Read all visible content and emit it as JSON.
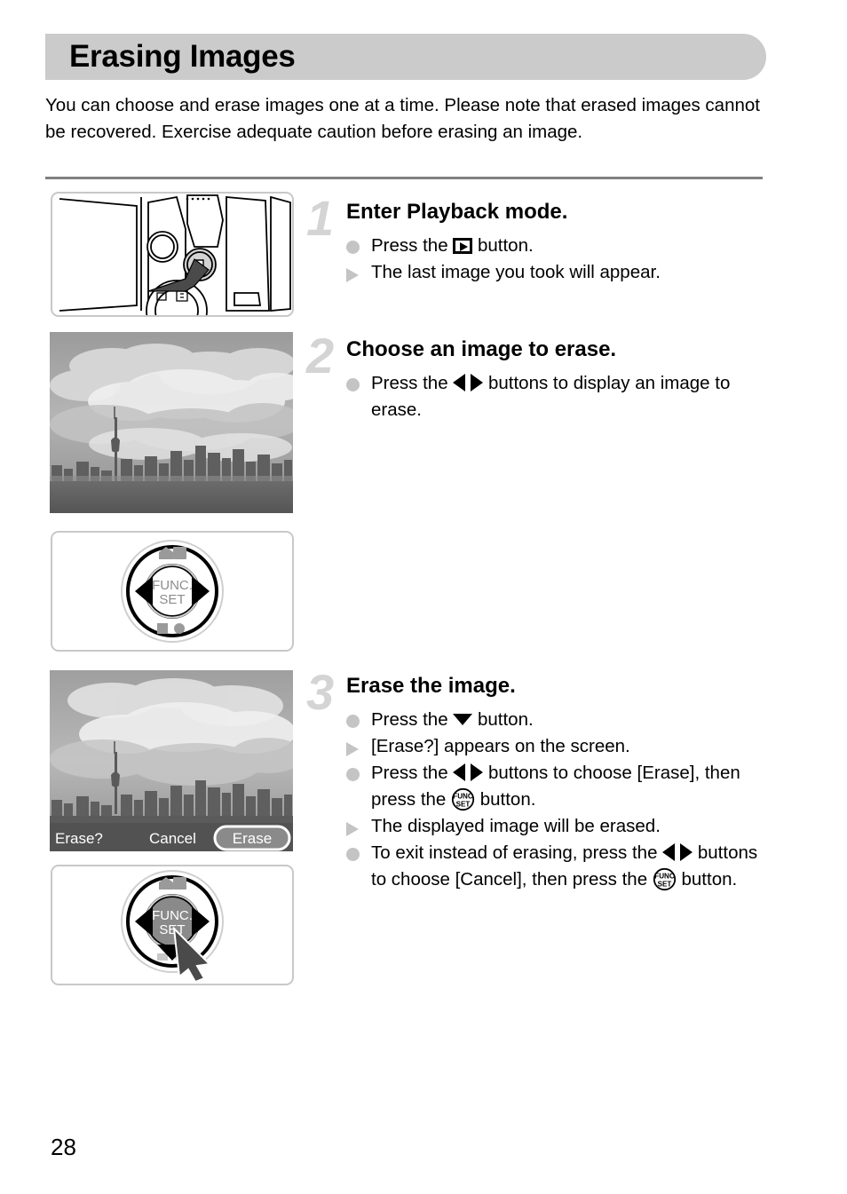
{
  "page": {
    "title": "Erasing Images",
    "number": "28",
    "intro": "You can choose and erase images one at a time. Please note that erased images cannot be recovered. Exercise adequate caution before erasing an image.",
    "accent_gray": "#cbcbcb",
    "rule_color": "#808080",
    "step_number_color": "#d4d4d4",
    "marker_color": "#c4c4c4"
  },
  "steps": [
    {
      "number": "1",
      "heading": "Enter Playback mode.",
      "lines": [
        {
          "marker": "dot",
          "parts": [
            {
              "type": "text",
              "value": "Press the "
            },
            {
              "type": "icon",
              "value": "playback-button-icon"
            },
            {
              "type": "text",
              "value": " button."
            }
          ]
        },
        {
          "marker": "triangle",
          "parts": [
            {
              "type": "text",
              "value": "The last image you took will appear."
            }
          ]
        }
      ]
    },
    {
      "number": "2",
      "heading": "Choose an image to erase.",
      "lines": [
        {
          "marker": "dot",
          "parts": [
            {
              "type": "text",
              "value": "Press the "
            },
            {
              "type": "icon",
              "value": "left-right-buttons-icon"
            },
            {
              "type": "text",
              "value": " buttons to display an image to erase."
            }
          ]
        }
      ]
    },
    {
      "number": "3",
      "heading": "Erase the image.",
      "lines": [
        {
          "marker": "dot",
          "parts": [
            {
              "type": "text",
              "value": "Press the "
            },
            {
              "type": "icon",
              "value": "down-button-icon"
            },
            {
              "type": "text",
              "value": " button."
            }
          ]
        },
        {
          "marker": "triangle",
          "parts": [
            {
              "type": "text",
              "value": "[Erase?] appears on the screen."
            }
          ]
        },
        {
          "marker": "dot",
          "parts": [
            {
              "type": "text",
              "value": "Press the "
            },
            {
              "type": "icon",
              "value": "left-right-buttons-icon"
            },
            {
              "type": "text",
              "value": " buttons to choose [Erase], then press the "
            },
            {
              "type": "icon",
              "value": "func-set-button-icon"
            },
            {
              "type": "text",
              "value": " button."
            }
          ]
        },
        {
          "marker": "triangle",
          "parts": [
            {
              "type": "text",
              "value": "The displayed image will be erased."
            }
          ]
        },
        {
          "marker": "dot",
          "parts": [
            {
              "type": "text",
              "value": "To exit instead of erasing, press the "
            },
            {
              "type": "icon",
              "value": "left-right-buttons-icon"
            },
            {
              "type": "text",
              "value": " buttons to choose [Cancel], then press the "
            },
            {
              "type": "icon",
              "value": "func-set-button-icon"
            },
            {
              "type": "text",
              "value": " button."
            }
          ]
        }
      ]
    }
  ],
  "figures": {
    "camera_back": {
      "name": "camera-back-illustration",
      "description": "Rear of camera with playback button pressed"
    },
    "skyline_photo": {
      "name": "skyline-photo",
      "description": "City skyline with tower and clouds"
    },
    "dial_lr": {
      "name": "control-dial-left-right",
      "center_label_line1": "FUNC.",
      "center_label_line2": "SET"
    },
    "erase_screen": {
      "name": "erase-confirmation-screen",
      "prompt": "Erase?",
      "cancel_label": "Cancel",
      "erase_label": "Erase",
      "selected": "Erase"
    },
    "dial_set": {
      "name": "control-dial-func-set",
      "center_label_line1": "FUNC.",
      "center_label_line2": "SET"
    }
  }
}
